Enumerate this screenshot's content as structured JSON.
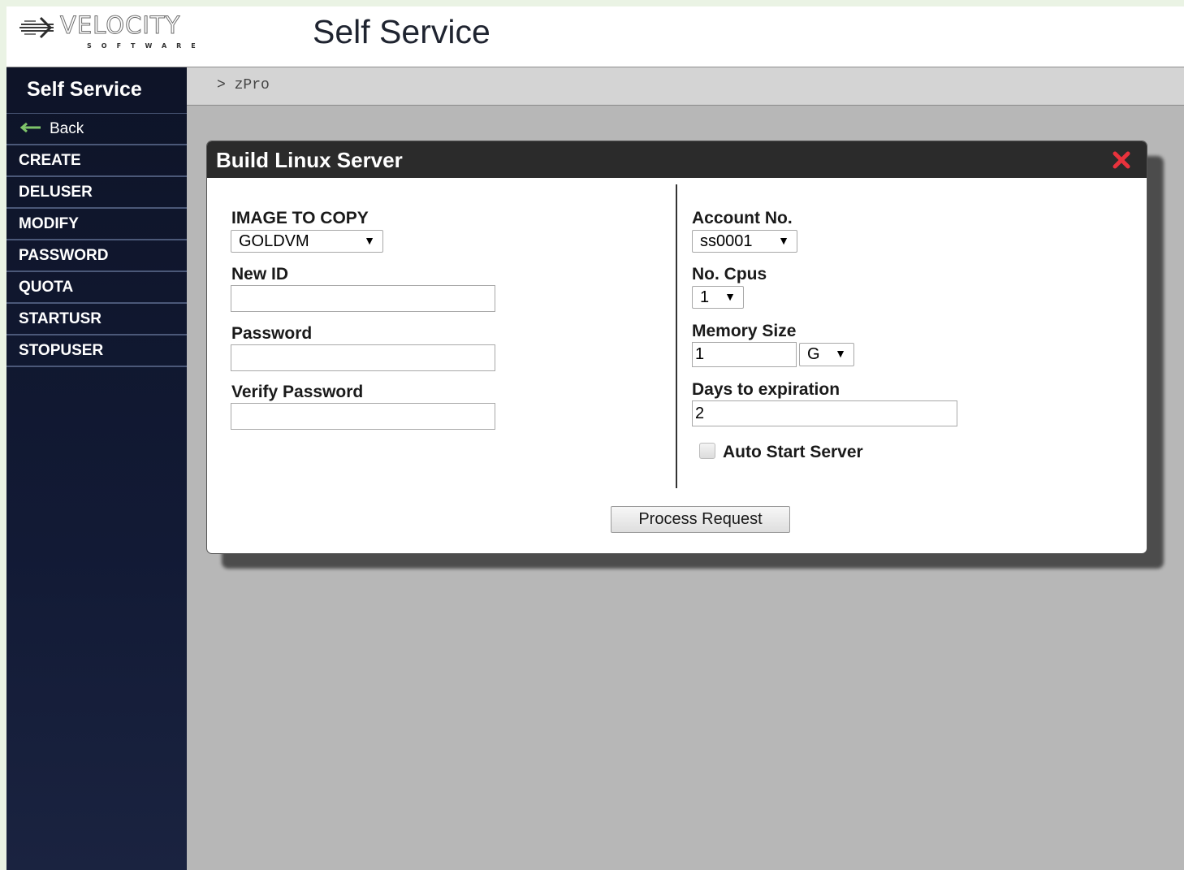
{
  "header": {
    "logo_text": "VELOCITY",
    "logo_subtext": "SOFTWARE",
    "title": "Self Service"
  },
  "sidebar": {
    "title": "Self Service",
    "back_label": "Back",
    "items": [
      {
        "label": "CREATE"
      },
      {
        "label": "DELUSER"
      },
      {
        "label": "MODIFY"
      },
      {
        "label": "PASSWORD"
      },
      {
        "label": "QUOTA"
      },
      {
        "label": "STARTUSR"
      },
      {
        "label": "STOPUSER"
      }
    ]
  },
  "breadcrumb": {
    "text": "> zPro"
  },
  "dialog": {
    "title": "Build Linux Server",
    "left": {
      "image_label": "IMAGE TO COPY",
      "image_value": "GOLDVM",
      "new_id_label": "New ID",
      "new_id_value": "",
      "password_label": "Password",
      "password_value": "",
      "verify_label": "Verify Password",
      "verify_value": ""
    },
    "right": {
      "account_label": "Account No.",
      "account_value": "ss0001",
      "cpus_label": "No. Cpus",
      "cpus_value": "1",
      "memory_label": "Memory Size",
      "memory_value": "1",
      "memory_unit": "G",
      "days_label": "Days to expiration",
      "days_value": "2",
      "auto_start_label": "Auto Start Server",
      "auto_start_checked": false
    },
    "submit_label": "Process Request"
  },
  "colors": {
    "sidebar_bg": "#121a35",
    "main_bg": "#b7b7b7",
    "dialog_header": "#2b2b2b",
    "close_icon": "#e8323c",
    "back_arrow": "#7ec46a"
  },
  "icons": {
    "logo": "velocity-logo-icon",
    "back": "back-arrow-icon",
    "close": "close-icon",
    "dropdown": "chevron-down-icon"
  }
}
